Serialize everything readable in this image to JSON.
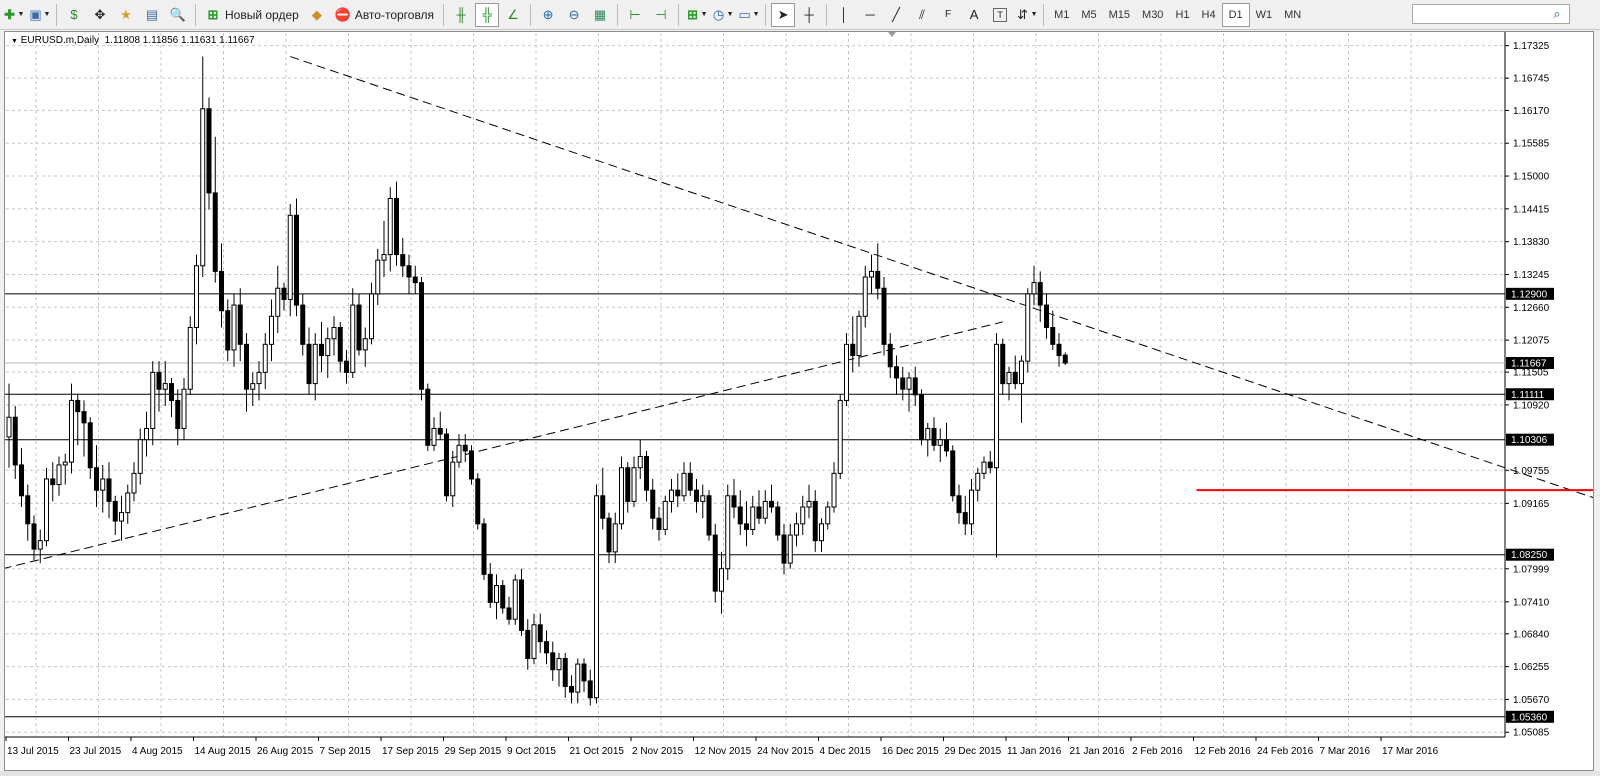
{
  "toolbar": {
    "new_order_label": "Новый ордер",
    "auto_trading_label": "Авто-торговля",
    "timeframes": [
      "M1",
      "M5",
      "M15",
      "M30",
      "H1",
      "H4",
      "D1",
      "W1",
      "MN"
    ],
    "active_timeframe": "D1",
    "search_value": ""
  },
  "chart": {
    "symbol_line": "EURUSD.m,Daily",
    "ohlc_line": "1.11808 1.11856 1.11631 1.11667"
  },
  "chart_data": {
    "type": "candlestick",
    "symbol": "EURUSD.m",
    "timeframe": "Daily",
    "current_price": "1.11667",
    "ylim": [
      1.05,
      1.1755
    ],
    "y_ticks": [
      "1.17325",
      "1.16745",
      "1.16170",
      "1.15585",
      "1.15000",
      "1.14415",
      "1.13830",
      "1.13245",
      "1.12660",
      "1.12075",
      "1.11505",
      "1.10920",
      "1.09755",
      "1.09165",
      "1.07999",
      "1.07410",
      "1.06840",
      "1.06255",
      "1.05670",
      "1.05085"
    ],
    "x_ticks": [
      "13 Jul 2015",
      "23 Jul 2015",
      "4 Aug 2015",
      "14 Aug 2015",
      "26 Aug 2015",
      "7 Sep 2015",
      "17 Sep 2015",
      "29 Sep 2015",
      "9 Oct 2015",
      "21 Oct 2015",
      "2 Nov 2015",
      "12 Nov 2015",
      "24 Nov 2015",
      "4 Dec 2015",
      "16 Dec 2015",
      "29 Dec 2015",
      "11 Jan 2016",
      "21 Jan 2016",
      "2 Feb 2016",
      "12 Feb 2016",
      "24 Feb 2016",
      "7 Mar 2016",
      "17 Mar 2016"
    ],
    "h_lines": [
      {
        "price": 1.129,
        "label": "1.12900"
      },
      {
        "price": 1.1111,
        "label": "1.11111"
      },
      {
        "price": 1.103,
        "label": "1.10306"
      },
      {
        "price": 1.0825,
        "label": "1.08250"
      },
      {
        "price": 1.0536,
        "label": "1.05360"
      }
    ],
    "close_marker": {
      "price": 1.11667,
      "label": "1.11667"
    },
    "trend_lines": [
      {
        "style": "dashed",
        "from": {
          "bar": 45,
          "price": 1.1713
        },
        "to": {
          "bar": 290,
          "price": 1.0789
        }
      },
      {
        "style": "dashed",
        "from": {
          "bar": -1,
          "price": 1.08
        },
        "to": {
          "bar": 159,
          "price": 1.124
        }
      }
    ],
    "red_lines": [
      {
        "from": {
          "bar": 190,
          "price": 1.094
        },
        "to": {
          "bar": 275,
          "price": 1.094
        }
      },
      {
        "from": {
          "bar": 268,
          "price": 1.0825
        },
        "to": {
          "bar": 273,
          "price": 1.0825
        }
      }
    ],
    "candles": [
      [
        1.1035,
        1.113,
        1.098,
        1.107
      ],
      [
        1.107,
        1.109,
        1.096,
        1.0985
      ],
      [
        1.0985,
        1.1015,
        1.091,
        1.093
      ],
      [
        1.093,
        1.095,
        1.085,
        1.088
      ],
      [
        1.088,
        1.0895,
        1.0815,
        1.0835
      ],
      [
        1.0835,
        1.087,
        1.081,
        1.085
      ],
      [
        1.085,
        1.098,
        1.084,
        1.096
      ],
      [
        1.096,
        1.099,
        1.092,
        1.095
      ],
      [
        1.095,
        1.1,
        1.093,
        1.0985
      ],
      [
        1.0985,
        1.1005,
        1.095,
        1.099
      ],
      [
        1.099,
        1.113,
        1.097,
        1.11
      ],
      [
        1.11,
        1.111,
        1.102,
        1.108
      ],
      [
        1.108,
        1.11,
        1.1,
        1.106
      ],
      [
        1.106,
        1.107,
        1.096,
        1.098
      ],
      [
        1.098,
        1.102,
        1.091,
        1.094
      ],
      [
        1.094,
        1.0985,
        1.09,
        1.096
      ],
      [
        1.096,
        1.099,
        1.089,
        1.092
      ],
      [
        1.092,
        1.093,
        1.086,
        1.0885
      ],
      [
        1.0885,
        1.093,
        1.085,
        1.09
      ],
      [
        1.09,
        1.095,
        1.088,
        1.0935
      ],
      [
        1.0935,
        1.099,
        1.092,
        1.097
      ],
      [
        1.097,
        1.105,
        1.095,
        1.103
      ],
      [
        1.103,
        1.108,
        1.1,
        1.105
      ],
      [
        1.105,
        1.117,
        1.102,
        1.115
      ],
      [
        1.115,
        1.117,
        1.108,
        1.112
      ],
      [
        1.112,
        1.117,
        1.109,
        1.113
      ],
      [
        1.113,
        1.114,
        1.107,
        1.11
      ],
      [
        1.11,
        1.112,
        1.102,
        1.105
      ],
      [
        1.105,
        1.114,
        1.103,
        1.112
      ],
      [
        1.112,
        1.125,
        1.111,
        1.123
      ],
      [
        1.123,
        1.136,
        1.12,
        1.134
      ],
      [
        1.134,
        1.1713,
        1.132,
        1.162
      ],
      [
        1.162,
        1.164,
        1.144,
        1.147
      ],
      [
        1.147,
        1.157,
        1.131,
        1.133
      ],
      [
        1.133,
        1.138,
        1.123,
        1.126
      ],
      [
        1.126,
        1.128,
        1.117,
        1.119
      ],
      [
        1.119,
        1.129,
        1.116,
        1.127
      ],
      [
        1.127,
        1.13,
        1.117,
        1.12
      ],
      [
        1.12,
        1.122,
        1.108,
        1.112
      ],
      [
        1.112,
        1.115,
        1.109,
        1.113
      ],
      [
        1.113,
        1.117,
        1.11,
        1.115
      ],
      [
        1.115,
        1.122,
        1.112,
        1.12
      ],
      [
        1.12,
        1.128,
        1.117,
        1.125
      ],
      [
        1.125,
        1.134,
        1.122,
        1.13
      ],
      [
        1.13,
        1.131,
        1.126,
        1.128
      ],
      [
        1.128,
        1.145,
        1.125,
        1.143
      ],
      [
        1.143,
        1.146,
        1.125,
        1.127
      ],
      [
        1.127,
        1.129,
        1.118,
        1.12
      ],
      [
        1.12,
        1.123,
        1.111,
        1.113
      ],
      [
        1.113,
        1.122,
        1.11,
        1.12
      ],
      [
        1.12,
        1.124,
        1.115,
        1.118
      ],
      [
        1.118,
        1.123,
        1.114,
        1.121
      ],
      [
        1.121,
        1.125,
        1.118,
        1.123
      ],
      [
        1.123,
        1.124,
        1.115,
        1.117
      ],
      [
        1.117,
        1.119,
        1.113,
        1.115
      ],
      [
        1.115,
        1.13,
        1.114,
        1.127
      ],
      [
        1.127,
        1.129,
        1.118,
        1.119
      ],
      [
        1.119,
        1.123,
        1.116,
        1.121
      ],
      [
        1.121,
        1.131,
        1.12,
        1.129
      ],
      [
        1.129,
        1.137,
        1.127,
        1.135
      ],
      [
        1.135,
        1.142,
        1.132,
        1.136
      ],
      [
        1.136,
        1.148,
        1.133,
        1.146
      ],
      [
        1.146,
        1.149,
        1.134,
        1.136
      ],
      [
        1.136,
        1.139,
        1.132,
        1.134
      ],
      [
        1.134,
        1.136,
        1.129,
        1.132
      ],
      [
        1.132,
        1.134,
        1.129,
        1.131
      ],
      [
        1.131,
        1.132,
        1.11,
        1.112
      ],
      [
        1.112,
        1.113,
        1.101,
        1.102
      ],
      [
        1.102,
        1.107,
        1.101,
        1.105
      ],
      [
        1.105,
        1.108,
        1.103,
        1.104
      ],
      [
        1.104,
        1.105,
        1.092,
        1.093
      ],
      [
        1.093,
        1.101,
        1.091,
        1.099
      ],
      [
        1.099,
        1.104,
        1.098,
        1.102
      ],
      [
        1.102,
        1.104,
        1.099,
        1.101
      ],
      [
        1.101,
        1.102,
        1.095,
        1.096
      ],
      [
        1.096,
        1.097,
        1.087,
        1.088
      ],
      [
        1.088,
        1.089,
        1.078,
        1.079
      ],
      [
        1.079,
        1.081,
        1.073,
        1.074
      ],
      [
        1.074,
        1.079,
        1.071,
        1.077
      ],
      [
        1.077,
        1.078,
        1.072,
        1.073
      ],
      [
        1.073,
        1.075,
        1.07,
        1.071
      ],
      [
        1.071,
        1.079,
        1.07,
        1.078
      ],
      [
        1.078,
        1.08,
        1.068,
        1.069
      ],
      [
        1.069,
        1.071,
        1.062,
        1.064
      ],
      [
        1.064,
        1.072,
        1.063,
        1.07
      ],
      [
        1.07,
        1.072,
        1.065,
        1.067
      ],
      [
        1.067,
        1.069,
        1.063,
        1.065
      ],
      [
        1.065,
        1.067,
        1.06,
        1.062
      ],
      [
        1.062,
        1.065,
        1.059,
        1.064
      ],
      [
        1.064,
        1.065,
        1.057,
        1.059
      ],
      [
        1.059,
        1.061,
        1.056,
        1.058
      ],
      [
        1.058,
        1.064,
        1.056,
        1.063
      ],
      [
        1.063,
        1.064,
        1.058,
        1.06
      ],
      [
        1.06,
        1.062,
        1.0556,
        1.057
      ],
      [
        1.057,
        1.095,
        1.056,
        1.093
      ],
      [
        1.093,
        1.098,
        1.087,
        1.089
      ],
      [
        1.089,
        1.09,
        1.081,
        1.083
      ],
      [
        1.083,
        1.09,
        1.081,
        1.088
      ],
      [
        1.088,
        1.1,
        1.087,
        1.098
      ],
      [
        1.098,
        1.099,
        1.09,
        1.092
      ],
      [
        1.092,
        1.1,
        1.091,
        1.098
      ],
      [
        1.098,
        1.103,
        1.096,
        1.1
      ],
      [
        1.1,
        1.101,
        1.092,
        1.094
      ],
      [
        1.094,
        1.096,
        1.087,
        1.089
      ],
      [
        1.089,
        1.091,
        1.085,
        1.087
      ],
      [
        1.087,
        1.093,
        1.086,
        1.092
      ],
      [
        1.092,
        1.096,
        1.09,
        1.094
      ],
      [
        1.094,
        1.097,
        1.091,
        1.093
      ],
      [
        1.093,
        1.099,
        1.092,
        1.097
      ],
      [
        1.097,
        1.099,
        1.093,
        1.094
      ],
      [
        1.094,
        1.096,
        1.09,
        1.092
      ],
      [
        1.092,
        1.095,
        1.089,
        1.093
      ],
      [
        1.093,
        1.094,
        1.085,
        1.086
      ],
      [
        1.086,
        1.088,
        1.074,
        1.076
      ],
      [
        1.076,
        1.083,
        1.072,
        1.08
      ],
      [
        1.08,
        1.095,
        1.078,
        1.093
      ],
      [
        1.093,
        1.096,
        1.089,
        1.091
      ],
      [
        1.091,
        1.094,
        1.086,
        1.088
      ],
      [
        1.088,
        1.092,
        1.084,
        1.087
      ],
      [
        1.087,
        1.093,
        1.086,
        1.091
      ],
      [
        1.091,
        1.094,
        1.088,
        1.089
      ],
      [
        1.089,
        1.094,
        1.088,
        1.092
      ],
      [
        1.092,
        1.095,
        1.09,
        1.091
      ],
      [
        1.091,
        1.092,
        1.085,
        1.086
      ],
      [
        1.086,
        1.088,
        1.079,
        1.081
      ],
      [
        1.081,
        1.088,
        1.08,
        1.086
      ],
      [
        1.086,
        1.09,
        1.084,
        1.088
      ],
      [
        1.088,
        1.093,
        1.086,
        1.091
      ],
      [
        1.091,
        1.095,
        1.089,
        1.092
      ],
      [
        1.092,
        1.094,
        1.083,
        1.085
      ],
      [
        1.085,
        1.089,
        1.083,
        1.088
      ],
      [
        1.088,
        1.092,
        1.087,
        1.091
      ],
      [
        1.091,
        1.099,
        1.09,
        1.097
      ],
      [
        1.097,
        1.111,
        1.096,
        1.11
      ],
      [
        1.11,
        1.122,
        1.109,
        1.12
      ],
      [
        1.12,
        1.125,
        1.115,
        1.118
      ],
      [
        1.118,
        1.126,
        1.116,
        1.125
      ],
      [
        1.125,
        1.134,
        1.123,
        1.132
      ],
      [
        1.132,
        1.136,
        1.129,
        1.133
      ],
      [
        1.133,
        1.138,
        1.128,
        1.13
      ],
      [
        1.13,
        1.132,
        1.118,
        1.12
      ],
      [
        1.12,
        1.122,
        1.114,
        1.116
      ],
      [
        1.116,
        1.118,
        1.111,
        1.114
      ],
      [
        1.114,
        1.116,
        1.11,
        1.112
      ],
      [
        1.112,
        1.115,
        1.108,
        1.114
      ],
      [
        1.114,
        1.116,
        1.109,
        1.111
      ],
      [
        1.111,
        1.112,
        1.102,
        1.103
      ],
      [
        1.103,
        1.106,
        1.1,
        1.105
      ],
      [
        1.105,
        1.107,
        1.101,
        1.102
      ],
      [
        1.102,
        1.105,
        1.099,
        1.103
      ],
      [
        1.103,
        1.106,
        1.1,
        1.101
      ],
      [
        1.101,
        1.102,
        1.092,
        1.093
      ],
      [
        1.093,
        1.095,
        1.088,
        1.09
      ],
      [
        1.09,
        1.093,
        1.086,
        1.088
      ],
      [
        1.088,
        1.096,
        1.086,
        1.094
      ],
      [
        1.094,
        1.098,
        1.092,
        1.097
      ],
      [
        1.097,
        1.1,
        1.096,
        1.099
      ],
      [
        1.099,
        1.101,
        1.097,
        1.098
      ],
      [
        1.098,
        1.122,
        1.082,
        1.12
      ],
      [
        1.12,
        1.121,
        1.111,
        1.113
      ],
      [
        1.113,
        1.116,
        1.11,
        1.115
      ],
      [
        1.115,
        1.118,
        1.112,
        1.113
      ],
      [
        1.113,
        1.118,
        1.106,
        1.117
      ],
      [
        1.117,
        1.13,
        1.115,
        1.129
      ],
      [
        1.129,
        1.134,
        1.127,
        1.131
      ],
      [
        1.131,
        1.133,
        1.124,
        1.127
      ],
      [
        1.127,
        1.129,
        1.121,
        1.123
      ],
      [
        1.123,
        1.126,
        1.119,
        1.12
      ],
      [
        1.12,
        1.122,
        1.116,
        1.118
      ],
      [
        1.11808,
        1.11856,
        1.11631,
        1.11667
      ]
    ]
  }
}
